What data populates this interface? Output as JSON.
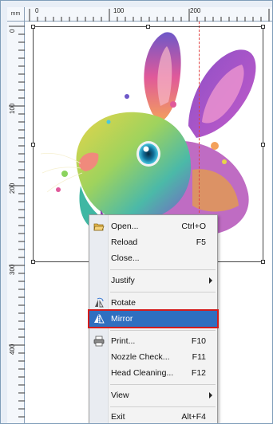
{
  "ruler": {
    "unit": "mm",
    "top_labels": [
      "0",
      "100",
      "200"
    ],
    "left_labels": [
      "0",
      "100",
      "200",
      "300",
      "400"
    ]
  },
  "image": {
    "subject": "colorful-rabbit-illustration"
  },
  "menu": {
    "items": [
      {
        "label": "Open...",
        "shortcut": "Ctrl+O",
        "icon": "folder-open-icon"
      },
      {
        "label": "Reload",
        "shortcut": "F5"
      },
      {
        "label": "Close..."
      },
      {
        "label": "Justify",
        "submenu": true
      },
      {
        "label": "Rotate",
        "icon": "rotate-icon"
      },
      {
        "label": "Mirror",
        "icon": "mirror-icon",
        "highlighted": true
      },
      {
        "label": "Print...",
        "shortcut": "F10",
        "icon": "printer-icon"
      },
      {
        "label": "Nozzle Check...",
        "shortcut": "F11"
      },
      {
        "label": "Head Cleaning...",
        "shortcut": "F12"
      },
      {
        "label": "View",
        "submenu": true
      },
      {
        "label": "Exit",
        "shortcut": "Alt+F4"
      }
    ]
  },
  "colors": {
    "highlight": "#2f6fc0",
    "highlight_border": "#d41c1c",
    "guide": "#e04040"
  }
}
